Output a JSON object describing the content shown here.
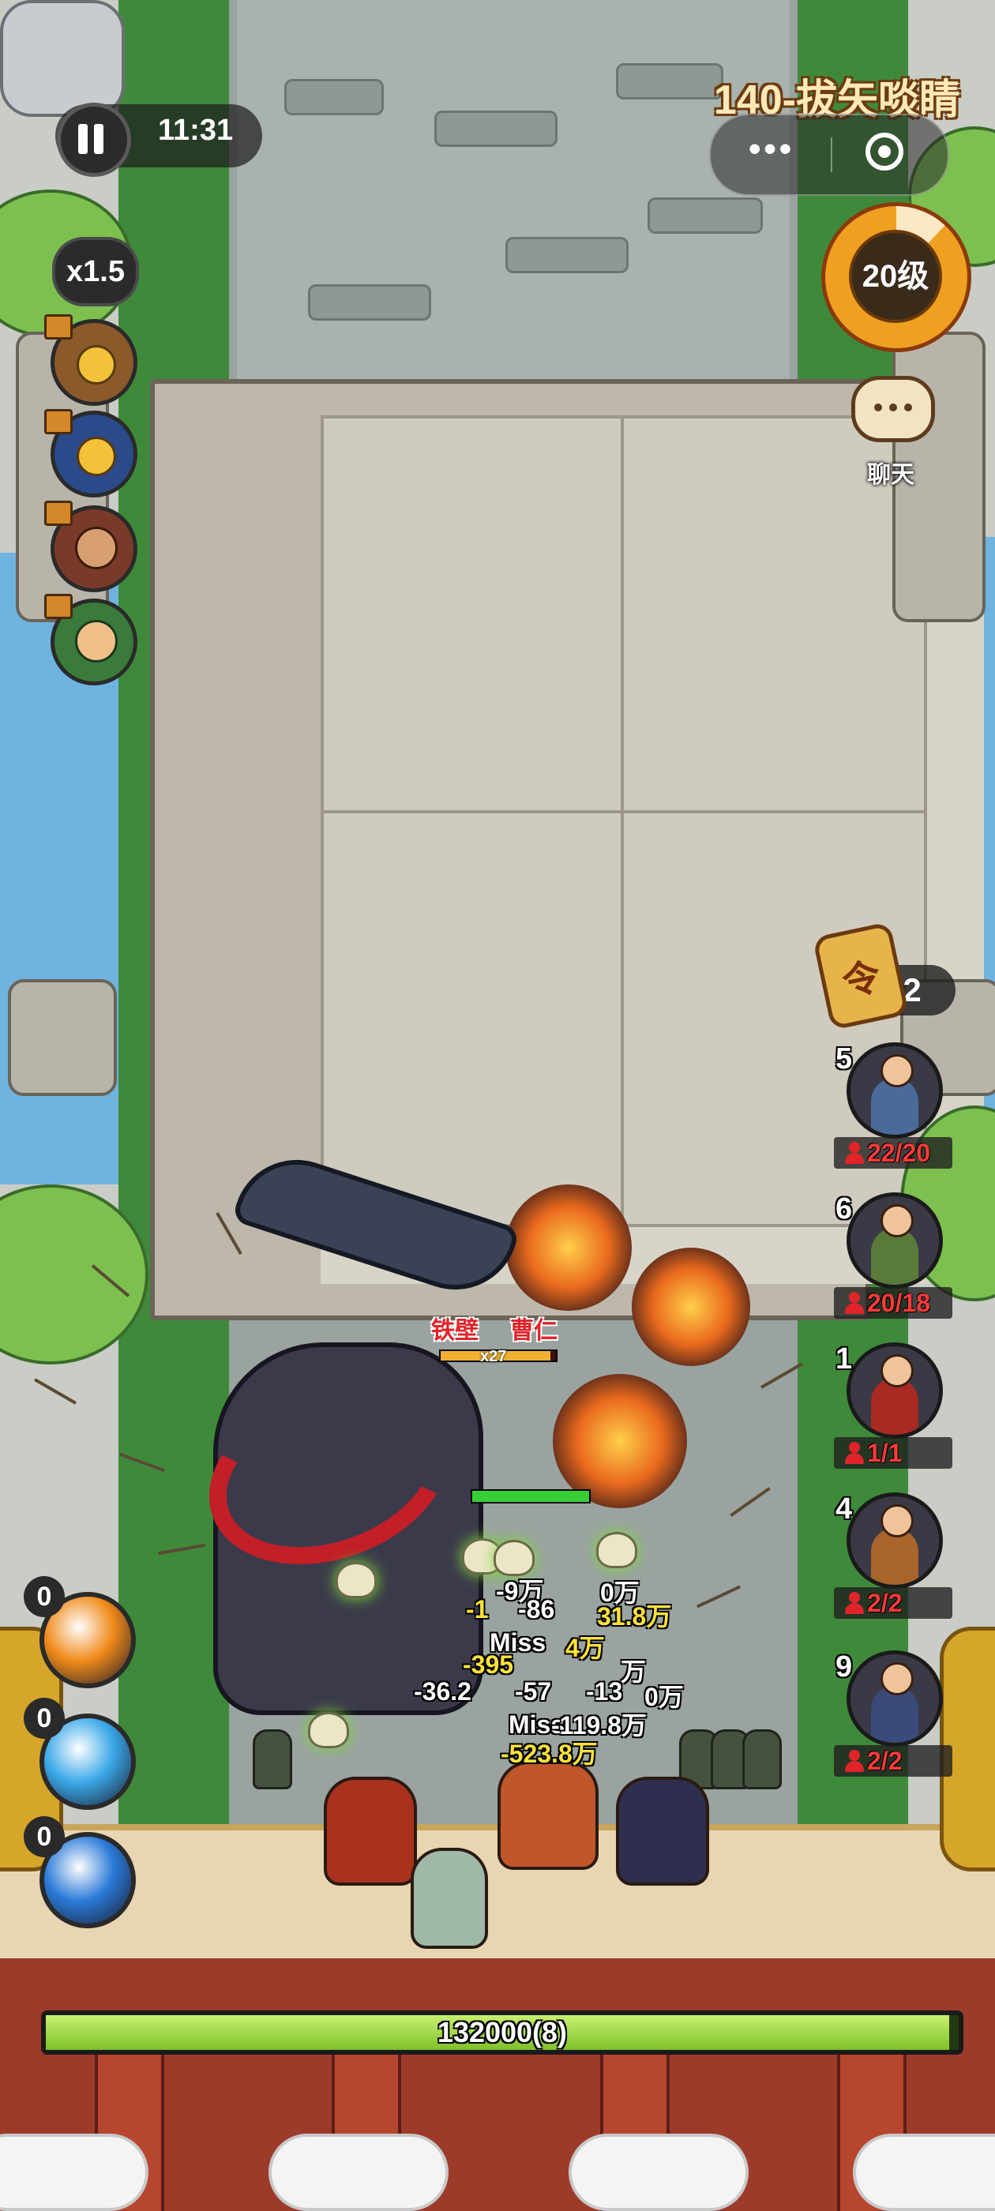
{
  "hud": {
    "timer": "11:31",
    "speed": "x1.5",
    "level_title": "140-拔矢啖睛",
    "player_level_label": "20级",
    "player_level_progress": 0.88,
    "chat_label": "聊天",
    "command_token_glyph": "令",
    "command_token_count": "2"
  },
  "hero_skills": [
    {
      "icon": "locked-hero-portrait-1"
    },
    {
      "icon": "locked-hero-portrait-2"
    },
    {
      "icon": "hero-portrait-bearded-general"
    },
    {
      "icon": "hero-portrait-green-warrior"
    }
  ],
  "boss": {
    "title": "铁壁",
    "name": "曹仁",
    "multiplier": "x27",
    "hp_fraction": 0.95
  },
  "damage_numbers": [
    {
      "text": "-9万",
      "style": "w"
    },
    {
      "text": "0万",
      "style": "w"
    },
    {
      "text": "-1",
      "style": "y"
    },
    {
      "text": "-86",
      "style": "w"
    },
    {
      "text": "31.8万",
      "style": "y"
    },
    {
      "text": "Miss",
      "style": "w"
    },
    {
      "text": "4万",
      "style": "y"
    },
    {
      "text": "-395",
      "style": "y"
    },
    {
      "text": "万",
      "style": "w"
    },
    {
      "text": "-36.2",
      "style": "w"
    },
    {
      "text": "-57",
      "style": "w"
    },
    {
      "text": "-13",
      "style": "w"
    },
    {
      "text": "0万",
      "style": "w"
    },
    {
      "text": "Miss",
      "style": "w"
    },
    {
      "text": "-119.8万",
      "style": "w"
    },
    {
      "text": "-523.8万",
      "style": "y"
    }
  ],
  "units": [
    {
      "level": "5",
      "count": "22/20",
      "color": "#4a6a9a"
    },
    {
      "level": "6",
      "count": "20/18",
      "color": "#5a7a3a"
    },
    {
      "level": "1",
      "count": "1/1",
      "color": "#a82a22"
    },
    {
      "level": "4",
      "count": "2/2",
      "color": "#a8642a"
    },
    {
      "level": "9",
      "count": "2/2",
      "color": "#3a4a7a"
    }
  ],
  "powers": [
    {
      "count": "0",
      "icon": "fire-hammer-icon",
      "color": "#f08a1a"
    },
    {
      "count": "0",
      "icon": "ice-burst-icon",
      "color": "#3aa8e8"
    },
    {
      "count": "0",
      "icon": "water-wave-icon",
      "color": "#2a7ad8"
    }
  ],
  "base": {
    "hp_text": "132000(8)",
    "hp_fraction": 0.99
  }
}
